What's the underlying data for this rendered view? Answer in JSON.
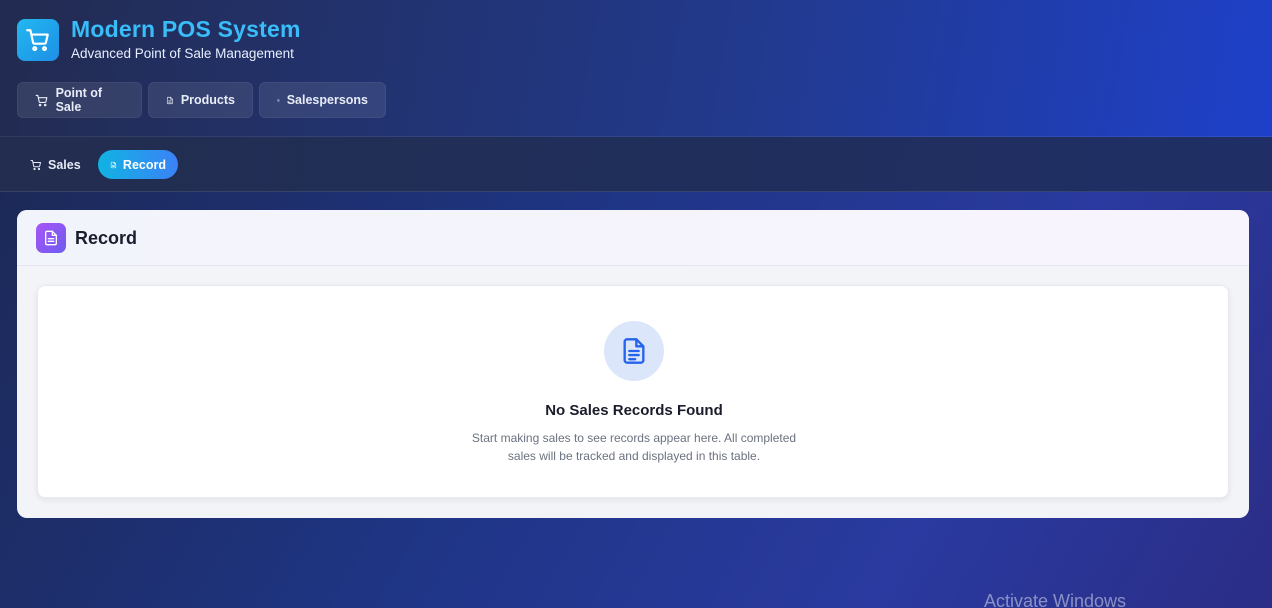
{
  "app": {
    "title": "Modern POS System",
    "subtitle": "Advanced Point of Sale Management",
    "logo_icon": "cart-icon",
    "accent_color": "#38bdf8"
  },
  "main_nav": {
    "items": [
      {
        "label": "Point of Sale",
        "icon": "cart-icon"
      },
      {
        "label": "Products",
        "icon": "document-icon"
      },
      {
        "label": "Salespersons",
        "icon": "dollar-icon"
      }
    ]
  },
  "sub_nav": {
    "items": [
      {
        "label": "Sales",
        "icon": "cart-icon",
        "active": false
      },
      {
        "label": "Record",
        "icon": "document-icon",
        "active": true
      }
    ]
  },
  "record_panel": {
    "title": "Record",
    "icon": "document-icon",
    "empty_state": {
      "icon": "document-icon",
      "title": "No Sales Records Found",
      "description": "Start making sales to see records appear here. All completed sales will be tracked and displayed in this table."
    }
  },
  "system": {
    "watermark": "Activate Windows"
  }
}
